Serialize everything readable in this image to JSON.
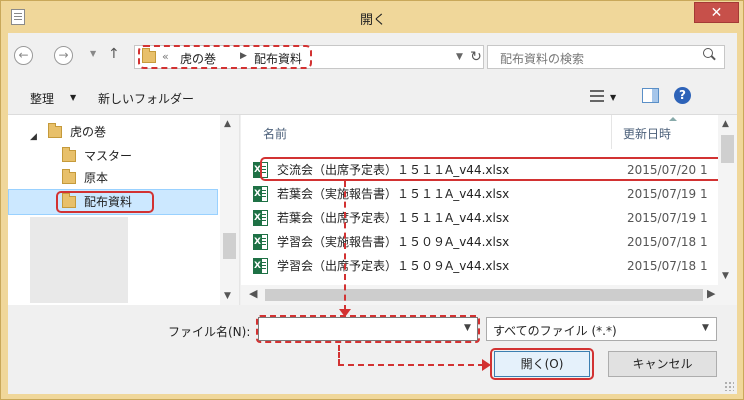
{
  "window": {
    "title": "開く",
    "close_glyph": "✕"
  },
  "nav": {
    "back_glyph": "←",
    "forward_glyph": "→",
    "up_glyph": "↑",
    "address_chevron": "«",
    "breadcrumb": [
      "虎の巻",
      "配布資料"
    ],
    "refresh_glyph": "↻",
    "search_placeholder": "配布資料の検索"
  },
  "toolbar": {
    "organize_label": "整理",
    "new_folder_label": "新しいフォルダー",
    "help_glyph": "?"
  },
  "tree": {
    "root_label": "虎の巻",
    "children": [
      "マスター",
      "原本",
      "配布資料"
    ],
    "selected": "配布資料"
  },
  "file_list": {
    "columns": {
      "name": "名前",
      "date": "更新日時"
    },
    "rows": [
      {
        "name": "交流会（出席予定表）１５１１A_v44.xlsx",
        "date": "2015/07/20 1"
      },
      {
        "name": "若葉会（実施報告書）１５１１A_v44.xlsx",
        "date": "2015/07/19 1"
      },
      {
        "name": "若葉会（出席予定表）１５１１A_v44.xlsx",
        "date": "2015/07/19 1"
      },
      {
        "name": "学習会（実施報告書）１５０９A_v44.xlsx",
        "date": "2015/07/18 1"
      },
      {
        "name": "学習会（出席予定表）１５０９A_v44.xlsx",
        "date": "2015/07/18 1"
      }
    ]
  },
  "bottom": {
    "filename_label": "ファイル名(N):",
    "filename_value": "",
    "filetype_value": "すべてのファイル (*.*)",
    "open_label": "開く(O)",
    "cancel_label": "キャンセル"
  },
  "colors": {
    "title_bar": "#f0d79a",
    "close_button": "#c7504a",
    "annotation": "#d23232",
    "selection": "#cce8ff"
  }
}
